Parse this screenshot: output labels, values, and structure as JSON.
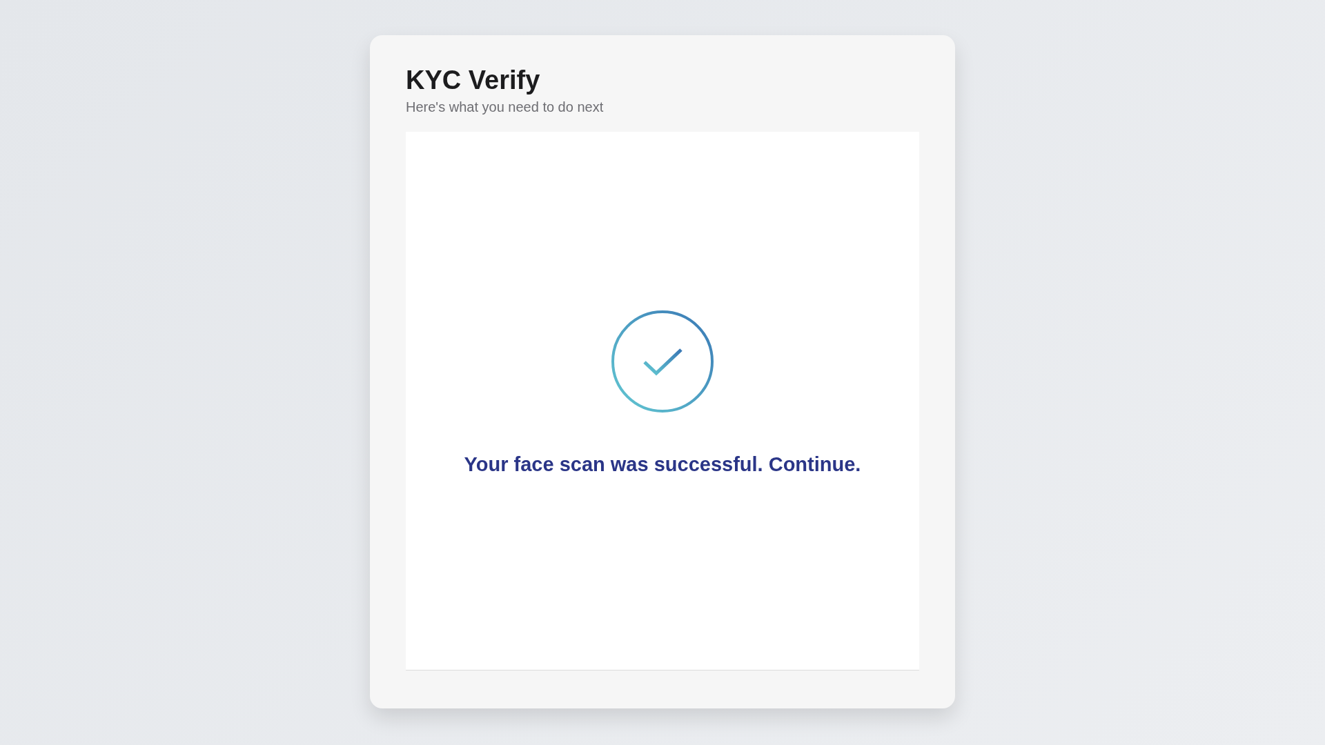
{
  "card": {
    "title": "KYC Verify",
    "subtitle": "Here's what you need to do next"
  },
  "status": {
    "message": "Your face scan was successful. Continue."
  }
}
